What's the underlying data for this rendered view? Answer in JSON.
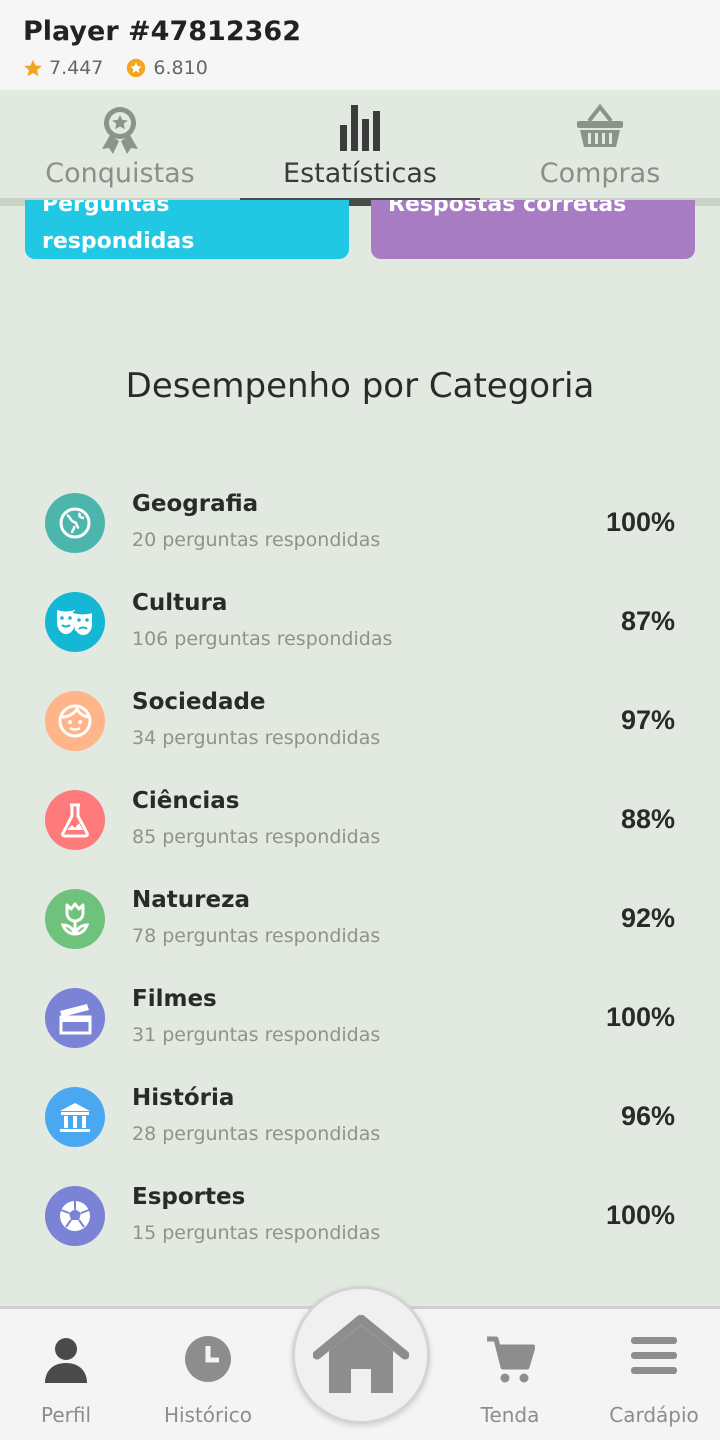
{
  "header": {
    "player_name": "Player #47812362",
    "stat_stars": "7.447",
    "stat_coins": "6.810"
  },
  "tabs": [
    {
      "label": "Conquistas",
      "icon": "medal-icon",
      "active": false
    },
    {
      "label": "Estatísticas",
      "icon": "bar-chart-icon",
      "active": true
    },
    {
      "label": "Compras",
      "icon": "basket-icon",
      "active": false
    }
  ],
  "cards": {
    "answered": {
      "line1": "Perguntas",
      "line2": "respondidas",
      "color": "#21c8e4"
    },
    "correct": {
      "line1": "Respostas corretas",
      "color": "#a87cc2"
    }
  },
  "section_title": "Desempenho por Categoria",
  "categories": [
    {
      "name": "Geografia",
      "count": "20 perguntas respondidas",
      "pct": "100%",
      "color": "#4db6ac",
      "icon": "globe-icon"
    },
    {
      "name": "Cultura",
      "count": "106 perguntas respondidas",
      "pct": "87%",
      "color": "#14b8d4",
      "icon": "theater-masks-icon"
    },
    {
      "name": "Sociedade",
      "count": "34 perguntas respondidas",
      "pct": "97%",
      "color": "#ffb48a",
      "icon": "face-icon"
    },
    {
      "name": "Ciências",
      "count": "85 perguntas respondidas",
      "pct": "88%",
      "color": "#ff7a7a",
      "icon": "flask-icon"
    },
    {
      "name": "Natureza",
      "count": "78 perguntas respondidas",
      "pct": "92%",
      "color": "#6fc27b",
      "icon": "tulip-icon"
    },
    {
      "name": "Filmes",
      "count": "31 perguntas respondidas",
      "pct": "100%",
      "color": "#7a83d6",
      "icon": "clapperboard-icon"
    },
    {
      "name": "História",
      "count": "28 perguntas respondidas",
      "pct": "96%",
      "color": "#4aa8f0",
      "icon": "museum-icon"
    },
    {
      "name": "Esportes",
      "count": "15 perguntas respondidas",
      "pct": "100%",
      "color": "#7a83d6",
      "icon": "soccer-ball-icon"
    }
  ],
  "bottom_nav": [
    {
      "label": "Perfil",
      "icon": "person-icon"
    },
    {
      "label": "Histórico",
      "icon": "clock-icon"
    },
    {
      "label": "",
      "icon": "home-icon"
    },
    {
      "label": "Tenda",
      "icon": "cart-icon"
    },
    {
      "label": "Cardápio",
      "icon": "menu-icon"
    }
  ]
}
